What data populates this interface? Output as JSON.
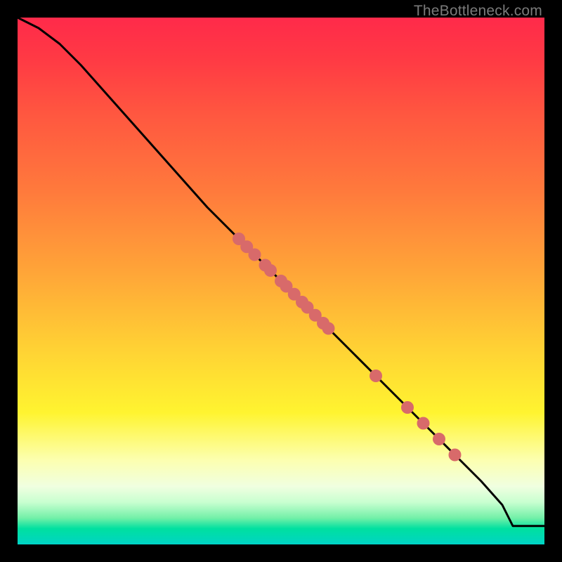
{
  "watermark": "TheBottleneck.com",
  "colors": {
    "frame": "#000000",
    "line": "#000000",
    "dot": "#d86a6a",
    "gradient_top": "#ff2a4a",
    "gradient_mid": "#fff430",
    "gradient_bottom": "#00d4c8"
  },
  "chart_data": {
    "type": "line",
    "title": "",
    "xlabel": "",
    "ylabel": "",
    "xlim": [
      0,
      100
    ],
    "ylim": [
      0,
      100
    ],
    "grid": false,
    "series": [
      {
        "name": "curve",
        "x": [
          0,
          4,
          8,
          12,
          16,
          20,
          24,
          28,
          32,
          36,
          40,
          44,
          48,
          52,
          56,
          60,
          64,
          68,
          72,
          76,
          80,
          84,
          88,
          92,
          94,
          100
        ],
        "y": [
          100,
          98,
          95,
          91,
          86.5,
          82,
          77.5,
          73,
          68.5,
          64,
          60,
          56,
          52,
          48,
          44,
          40,
          36,
          32,
          28,
          24,
          20,
          16,
          12,
          7.5,
          3.5,
          3.5
        ]
      }
    ],
    "points": [
      {
        "x": 42,
        "y": 58
      },
      {
        "x": 43.5,
        "y": 56.5
      },
      {
        "x": 45,
        "y": 55
      },
      {
        "x": 47,
        "y": 53
      },
      {
        "x": 48,
        "y": 52
      },
      {
        "x": 50,
        "y": 50
      },
      {
        "x": 51,
        "y": 49
      },
      {
        "x": 52.5,
        "y": 47.5
      },
      {
        "x": 54,
        "y": 46
      },
      {
        "x": 55,
        "y": 45
      },
      {
        "x": 56.5,
        "y": 43.5
      },
      {
        "x": 58,
        "y": 42
      },
      {
        "x": 59,
        "y": 41
      },
      {
        "x": 68,
        "y": 32
      },
      {
        "x": 74,
        "y": 26
      },
      {
        "x": 77,
        "y": 23
      },
      {
        "x": 80,
        "y": 20
      },
      {
        "x": 83,
        "y": 17
      }
    ]
  }
}
